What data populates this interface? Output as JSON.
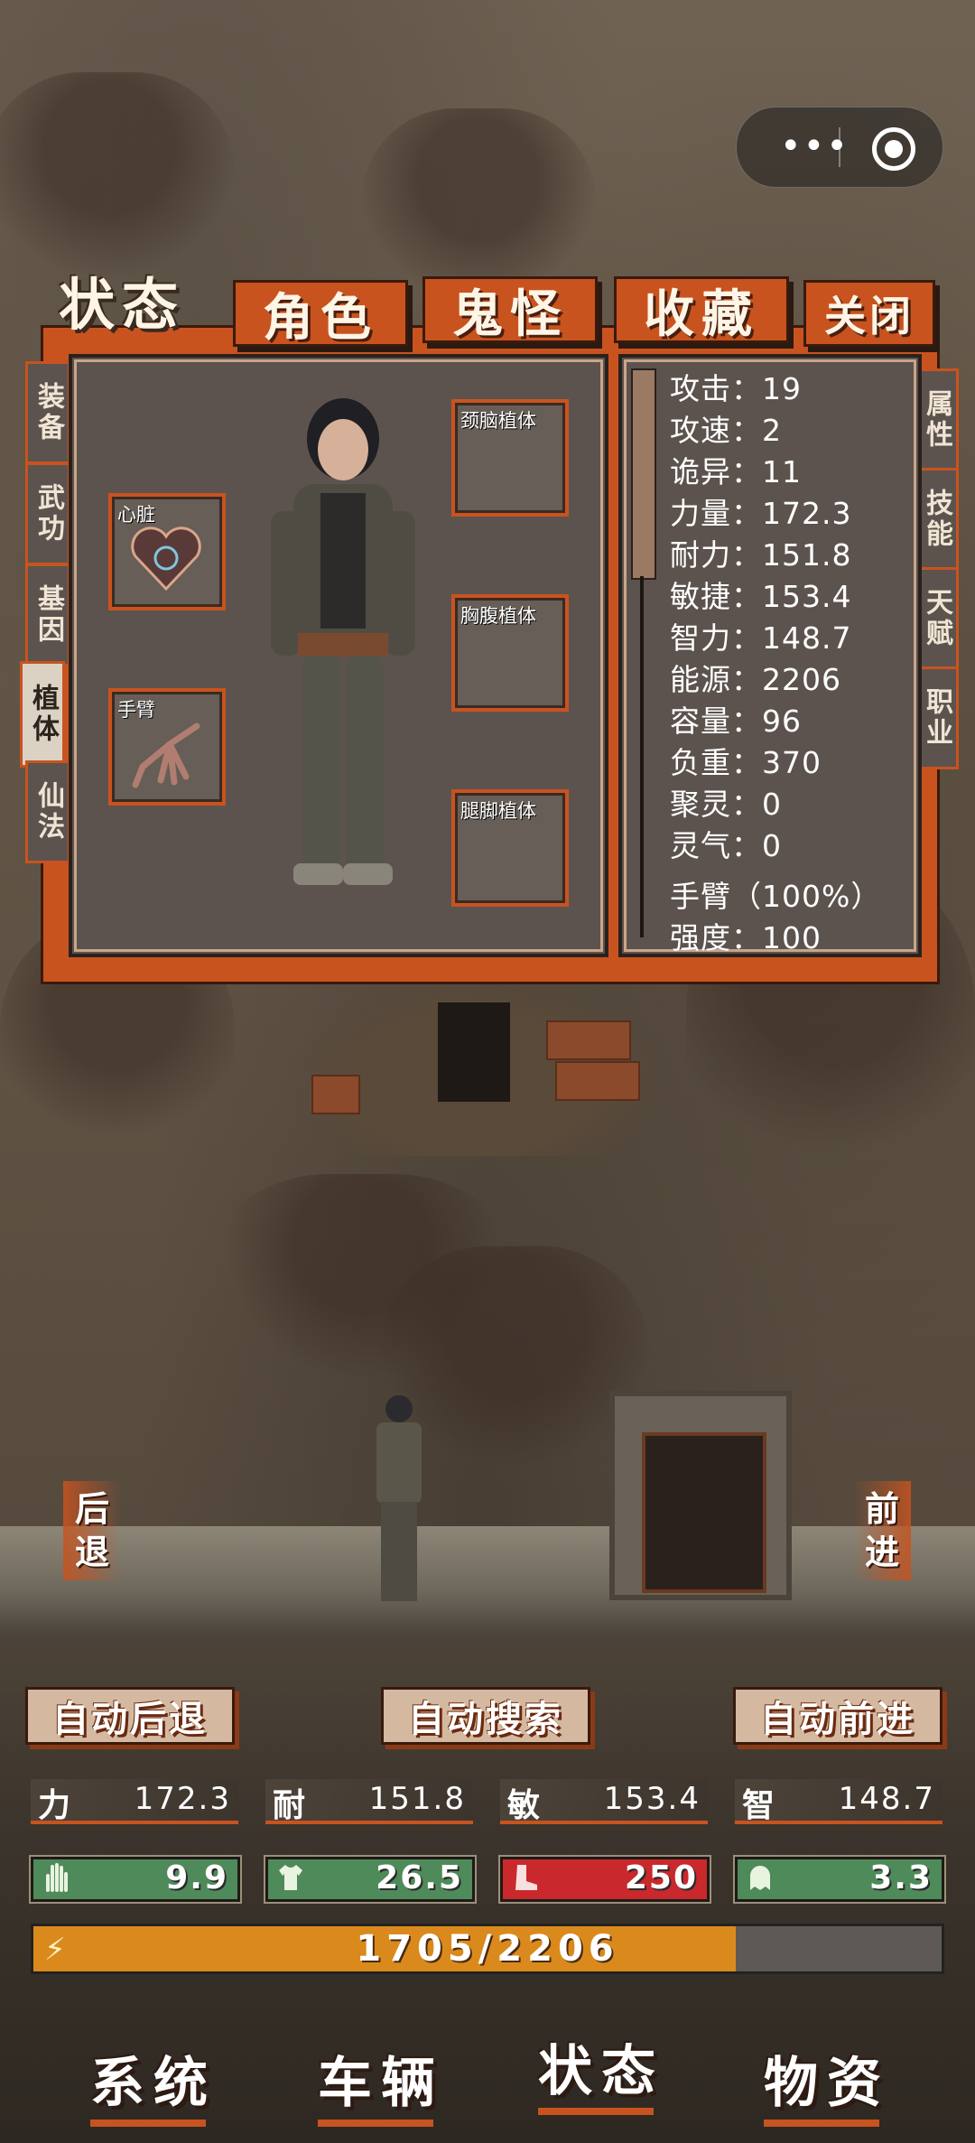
{
  "top_tabs": {
    "status": "状态",
    "role": "角色",
    "monster": "鬼怪",
    "collection": "收藏",
    "close": "关闭"
  },
  "left_side_tabs": [
    "装备",
    "武功",
    "基因",
    "植体",
    "仙法"
  ],
  "right_side_tabs": [
    "属性",
    "技能",
    "天赋",
    "职业"
  ],
  "slots": {
    "heart": "心脏",
    "arm": "手臂",
    "neck": "颈脑植体",
    "chest": "胸腹植体",
    "legs": "腿脚植体"
  },
  "stats": [
    "攻击：19",
    "攻速：2",
    "诡异：11",
    "力量：172.3",
    "耐力：151.8",
    "敏捷：153.4",
    "智力：148.7",
    "能源：2206",
    "容量：96",
    "负重：370",
    "聚灵：0",
    "灵气：0"
  ],
  "item_info": {
    "name": "手臂（100%）",
    "strength": "强度：100"
  },
  "nav": {
    "back": [
      "后",
      "退"
    ],
    "forward": [
      "前",
      "进"
    ]
  },
  "auto_buttons": {
    "retreat": "自动后退",
    "search": "自动搜索",
    "advance": "自动前进"
  },
  "attributes": [
    {
      "label": "力",
      "value": "172.3"
    },
    {
      "label": "耐",
      "value": "151.8"
    },
    {
      "label": "敏",
      "value": "153.4"
    },
    {
      "label": "智",
      "value": "148.7"
    }
  ],
  "gauges": [
    {
      "icon": "hand-icon",
      "value": "9.9",
      "color": "#4f8a5a"
    },
    {
      "icon": "shirt-icon",
      "value": "26.5",
      "color": "#4f8a5a"
    },
    {
      "icon": "boot-icon",
      "value": "250",
      "color": "#c9282c"
    },
    {
      "icon": "ghost-icon",
      "value": "3.3",
      "color": "#4f8a5a"
    }
  ],
  "energy": {
    "text": "1705/2206",
    "current": 1705,
    "max": 2206,
    "color": "#da8a1c"
  },
  "bottom_nav": {
    "system": "系统",
    "vehicle": "车辆",
    "status": "状态",
    "supplies": "物资"
  },
  "accent_color": "#c8531f"
}
